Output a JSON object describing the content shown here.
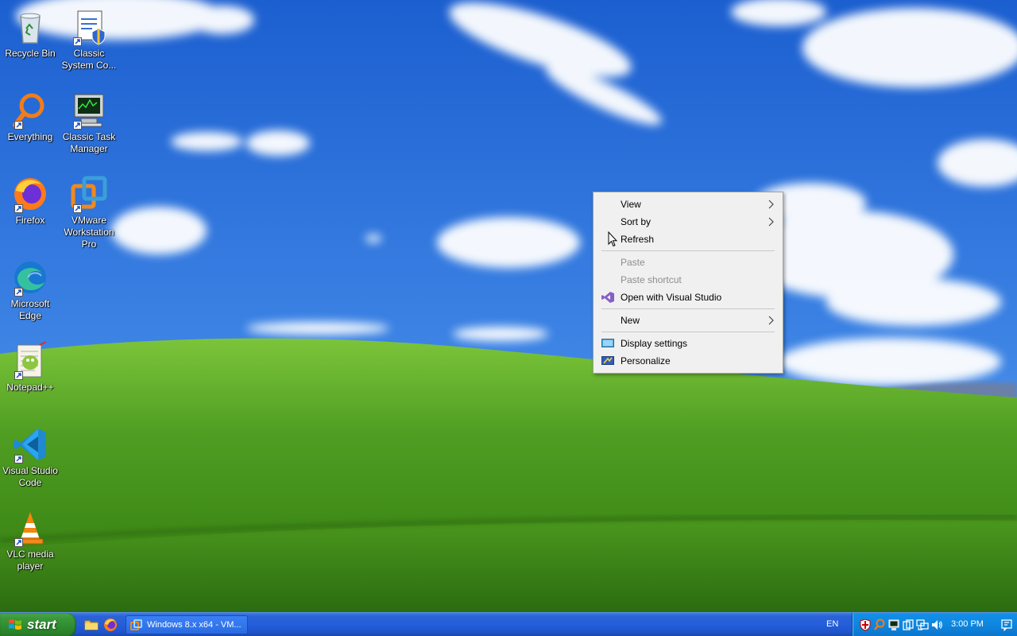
{
  "desktop": {
    "icons": [
      {
        "label": "Recycle Bin",
        "icon": "recycle-bin-icon"
      },
      {
        "label": "Classic System Co...",
        "icon": "system-config-icon"
      },
      {
        "label": "Everything",
        "icon": "search-magnifier-icon"
      },
      {
        "label": "Classic Task Manager",
        "icon": "task-manager-icon"
      },
      {
        "label": "Firefox",
        "icon": "firefox-icon"
      },
      {
        "label": "VMware Workstation Pro",
        "icon": "vmware-icon"
      },
      {
        "label": "Microsoft Edge",
        "icon": "edge-icon"
      },
      {
        "label": "Notepad++",
        "icon": "notepadpp-icon"
      },
      {
        "label": "Visual Studio Code",
        "icon": "vscode-icon"
      },
      {
        "label": "VLC media player",
        "icon": "vlc-icon"
      }
    ]
  },
  "context_menu": {
    "items": [
      {
        "label": "View",
        "submenu": true,
        "enabled": true
      },
      {
        "label": "Sort by",
        "submenu": true,
        "enabled": true
      },
      {
        "label": "Refresh",
        "enabled": true
      },
      {
        "label": "Paste",
        "enabled": false
      },
      {
        "label": "Paste shortcut",
        "enabled": false
      },
      {
        "label": "Open with Visual Studio",
        "enabled": true,
        "icon": "visual-studio-icon"
      },
      {
        "label": "New",
        "submenu": true,
        "enabled": true
      },
      {
        "label": "Display settings",
        "enabled": true,
        "icon": "display-icon"
      },
      {
        "label": "Personalize",
        "enabled": true,
        "icon": "personalize-icon"
      }
    ]
  },
  "taskbar": {
    "start_label": "start",
    "task_button_label": "Windows 8.x x64 - VM...",
    "language": "EN",
    "clock": "3:00 PM"
  },
  "colors": {
    "sky": "#2f6fd6",
    "grass": "#3f8f1f",
    "taskbar_blue": "#245edb",
    "start_green": "#3c9a3c",
    "tray_blue": "#0f86df"
  }
}
